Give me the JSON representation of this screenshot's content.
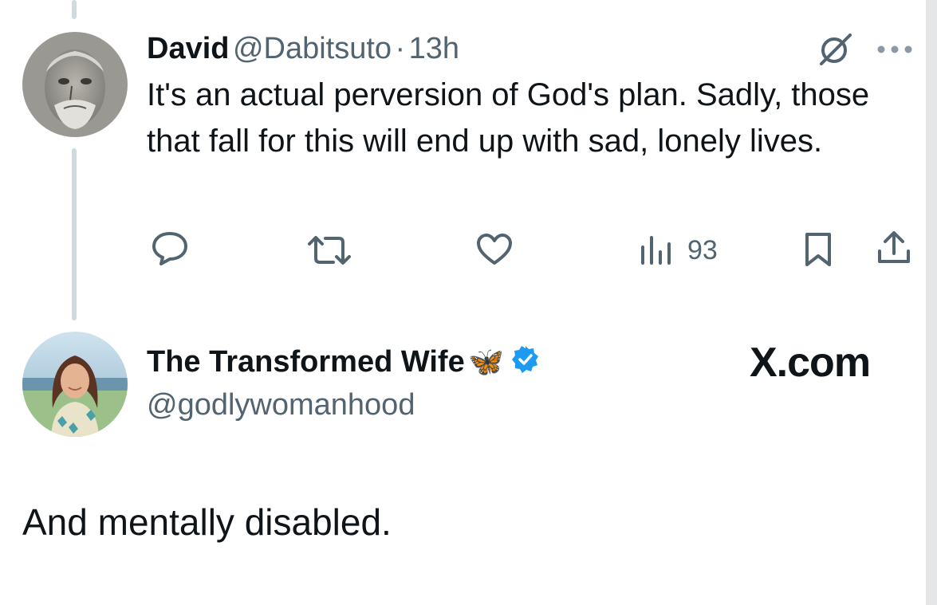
{
  "reply": {
    "author_name": "David",
    "author_handle": "@Dabitsuto",
    "separator": "·",
    "time": "13h",
    "text": "It's an actual perversion of God's plan. Sadly, those that fall for this will end up with sad, lonely lives.",
    "views_count": "93",
    "icons": [
      "grok-icon",
      "more-icon",
      "reply-icon",
      "retweet-icon",
      "like-icon",
      "views-icon",
      "bookmark-icon",
      "share-icon"
    ]
  },
  "main_post": {
    "author_name": "The Transformed Wife",
    "emoji": "🦋",
    "author_handle": "@godlywomanhood",
    "text": "And mentally disabled.",
    "verified": true
  },
  "watermark": "X.com",
  "colors": {
    "text": "#0f1419",
    "secondary": "#536471",
    "thread_line": "#cfd9de",
    "verified": "#1d9bf0"
  }
}
